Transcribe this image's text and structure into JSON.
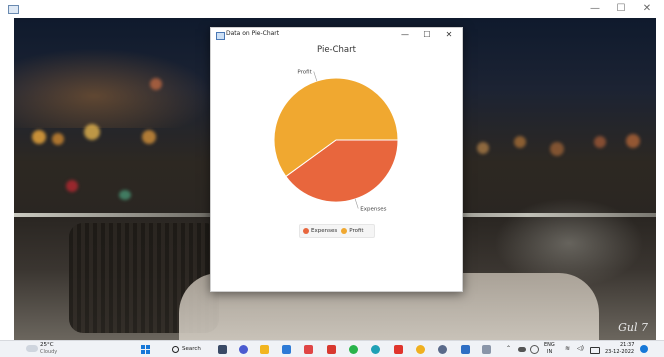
{
  "host_window": {
    "controls": {
      "minimize": "—",
      "maximize": "☐",
      "close": "✕"
    }
  },
  "app_window": {
    "title": "Data on Pie-Chart",
    "controls": {
      "minimize": "—",
      "maximize": "☐",
      "close": "✕"
    }
  },
  "chart_data": {
    "type": "pie",
    "title": "Pie-Chart",
    "slices": [
      {
        "name": "Expenses",
        "value": 40,
        "color": "#e8663d"
      },
      {
        "name": "Profit",
        "value": 60,
        "color": "#f0a830"
      }
    ],
    "legend": [
      "Expenses",
      "Profit"
    ],
    "legend_position": "bottom"
  },
  "desktop": {
    "signature": "Gul 7"
  },
  "taskbar": {
    "weather": {
      "temp": "25°C",
      "desc": "Cloudy"
    },
    "search_label": "Search",
    "tray": {
      "language": "ENG",
      "region": "IN",
      "time": "21:37",
      "date": "23-12-2022"
    },
    "accent": "#1778d8"
  }
}
